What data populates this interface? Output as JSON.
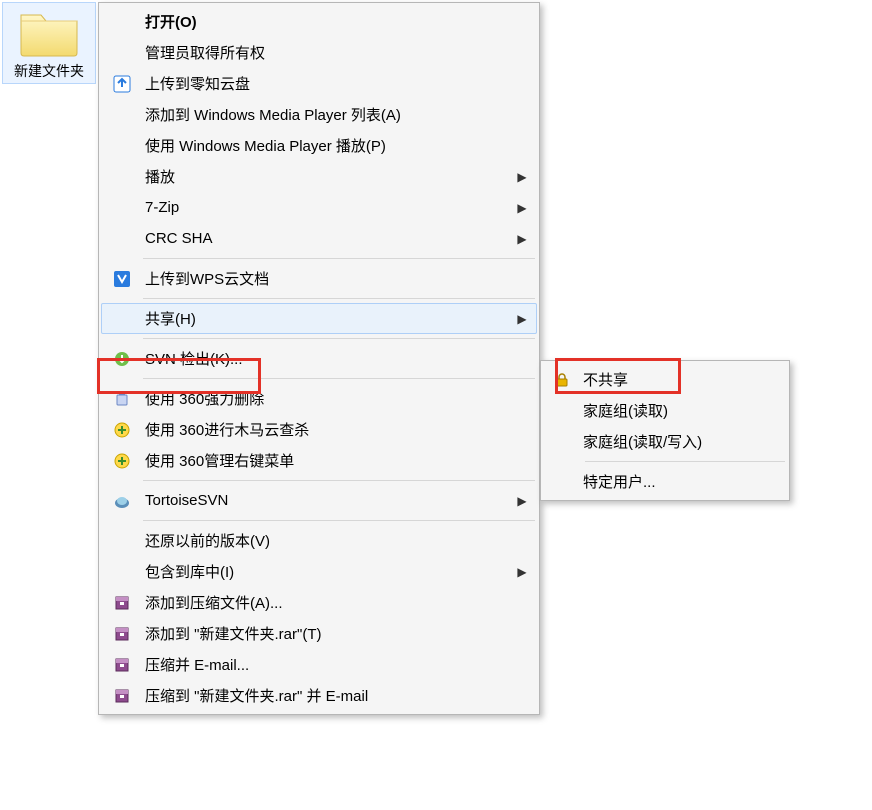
{
  "desktop": {
    "folder_label": "新建文件夹"
  },
  "menu": {
    "open": "打开(O)",
    "admin_take_ownership": "管理员取得所有权",
    "upload_lingzhi": "上传到零知云盘",
    "add_wmp_list": "添加到 Windows Media Player 列表(A)",
    "play_wmp": "使用 Windows Media Player 播放(P)",
    "play": "播放",
    "sevenzip": "7-Zip",
    "crc_sha": "CRC SHA",
    "upload_wps": "上传到WPS云文档",
    "share": "共享(H)",
    "svn_checkout": "SVN 检出(K)...",
    "use_360_force_delete": "使用 360强力删除",
    "use_360_trojan_scan": "使用 360进行木马云查杀",
    "use_360_manage_menu": "使用 360管理右键菜单",
    "tortoisesvn": "TortoiseSVN",
    "restore_previous": "还原以前的版本(V)",
    "include_in_library": "包含到库中(I)",
    "add_to_archive": "添加到压缩文件(A)...",
    "add_to_named_rar": "添加到 \"新建文件夹.rar\"(T)",
    "compress_email": "压缩并 E-mail...",
    "compress_named_email": "压缩到 \"新建文件夹.rar\" 并 E-mail"
  },
  "submenu": {
    "no_share": "不共享",
    "homegroup_read": "家庭组(读取)",
    "homegroup_readwrite": "家庭组(读取/写入)",
    "specific_users": "特定用户..."
  }
}
